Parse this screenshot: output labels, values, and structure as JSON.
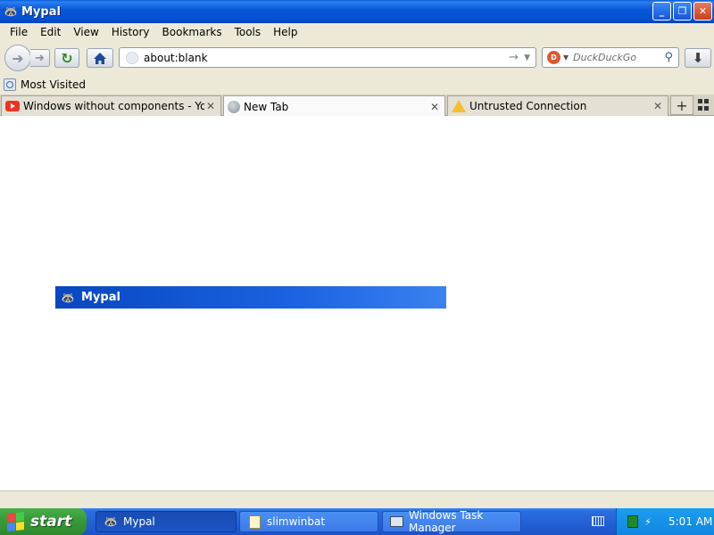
{
  "window": {
    "title": "Mypal",
    "icon": "mypal-raccoon-icon"
  },
  "menubar": {
    "items": [
      "File",
      "Edit",
      "View",
      "History",
      "Bookmarks",
      "Tools",
      "Help"
    ]
  },
  "navbar": {
    "url": "about:blank",
    "search_placeholder": "DuckDuckGo",
    "search_engine_icon": "duckduckgo-icon"
  },
  "bookmarks": {
    "most_visited": "Most Visited"
  },
  "tabs": [
    {
      "label": "Windows without components - YouTube",
      "icon": "youtube-icon",
      "active": false
    },
    {
      "label": "New Tab",
      "icon": "globe-icon",
      "active": true
    },
    {
      "label": "Untrusted Connection",
      "icon": "warning-icon",
      "active": false
    }
  ],
  "content": {
    "banner_title": "Mypal"
  },
  "taskbar": {
    "start_label": "start",
    "tasks": [
      {
        "label": "Mypal",
        "icon": "mypal-raccoon-icon",
        "active": true
      },
      {
        "label": "slimwinbat",
        "icon": "folder-icon",
        "active": false
      },
      {
        "label": "Windows Task Manager",
        "icon": "task-manager-icon",
        "active": false
      }
    ],
    "clock": "5:01 AM"
  },
  "colors": {
    "titlebar_blue": "#0450d0",
    "start_green": "#3a9a3a",
    "tray_blue": "#1285e0",
    "taskbar_blue": "#2462d8"
  }
}
